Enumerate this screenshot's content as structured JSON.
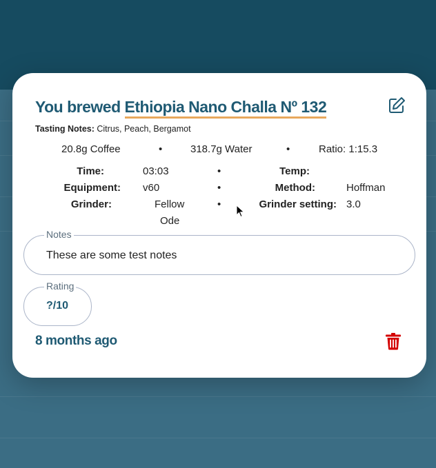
{
  "modal": {
    "title_prefix": "You brewed",
    "bean_name": "Ethiopia Nano Challa Nº 132",
    "tasting_notes_label": "Tasting Notes:",
    "tasting_notes": "Citrus, Peach, Bergamot",
    "coffee": "20.8g Coffee",
    "water": "318.7g Water",
    "ratio": "Ratio: 1:15.3",
    "separator": "•",
    "details": {
      "time_label": "Time:",
      "time_value": "03:03",
      "temp_label": "Temp:",
      "temp_value": "",
      "equipment_label": "Equipment:",
      "equipment_value": "v60",
      "method_label": "Method:",
      "method_value": "Hoffman",
      "grinder_label": "Grinder:",
      "grinder_value_line1": "Fellow",
      "grinder_value_line2": "Ode",
      "grinder_setting_label": "Grinder setting:",
      "grinder_setting_value": "3.0"
    },
    "notes_legend": "Notes",
    "notes_value": "These are some test notes",
    "rating_legend": "Rating",
    "rating_value": "?/10",
    "time_ago": "8 months ago"
  },
  "icons": {
    "edit": "pencil-square-icon",
    "delete": "trash-icon"
  },
  "colors": {
    "primary": "#1f5a73",
    "accent_underline": "#e8a85c",
    "delete": "#d40000",
    "field_border": "#aab4c8",
    "overlay_header": "#164b60",
    "overlay_body": "#3b6d84"
  }
}
